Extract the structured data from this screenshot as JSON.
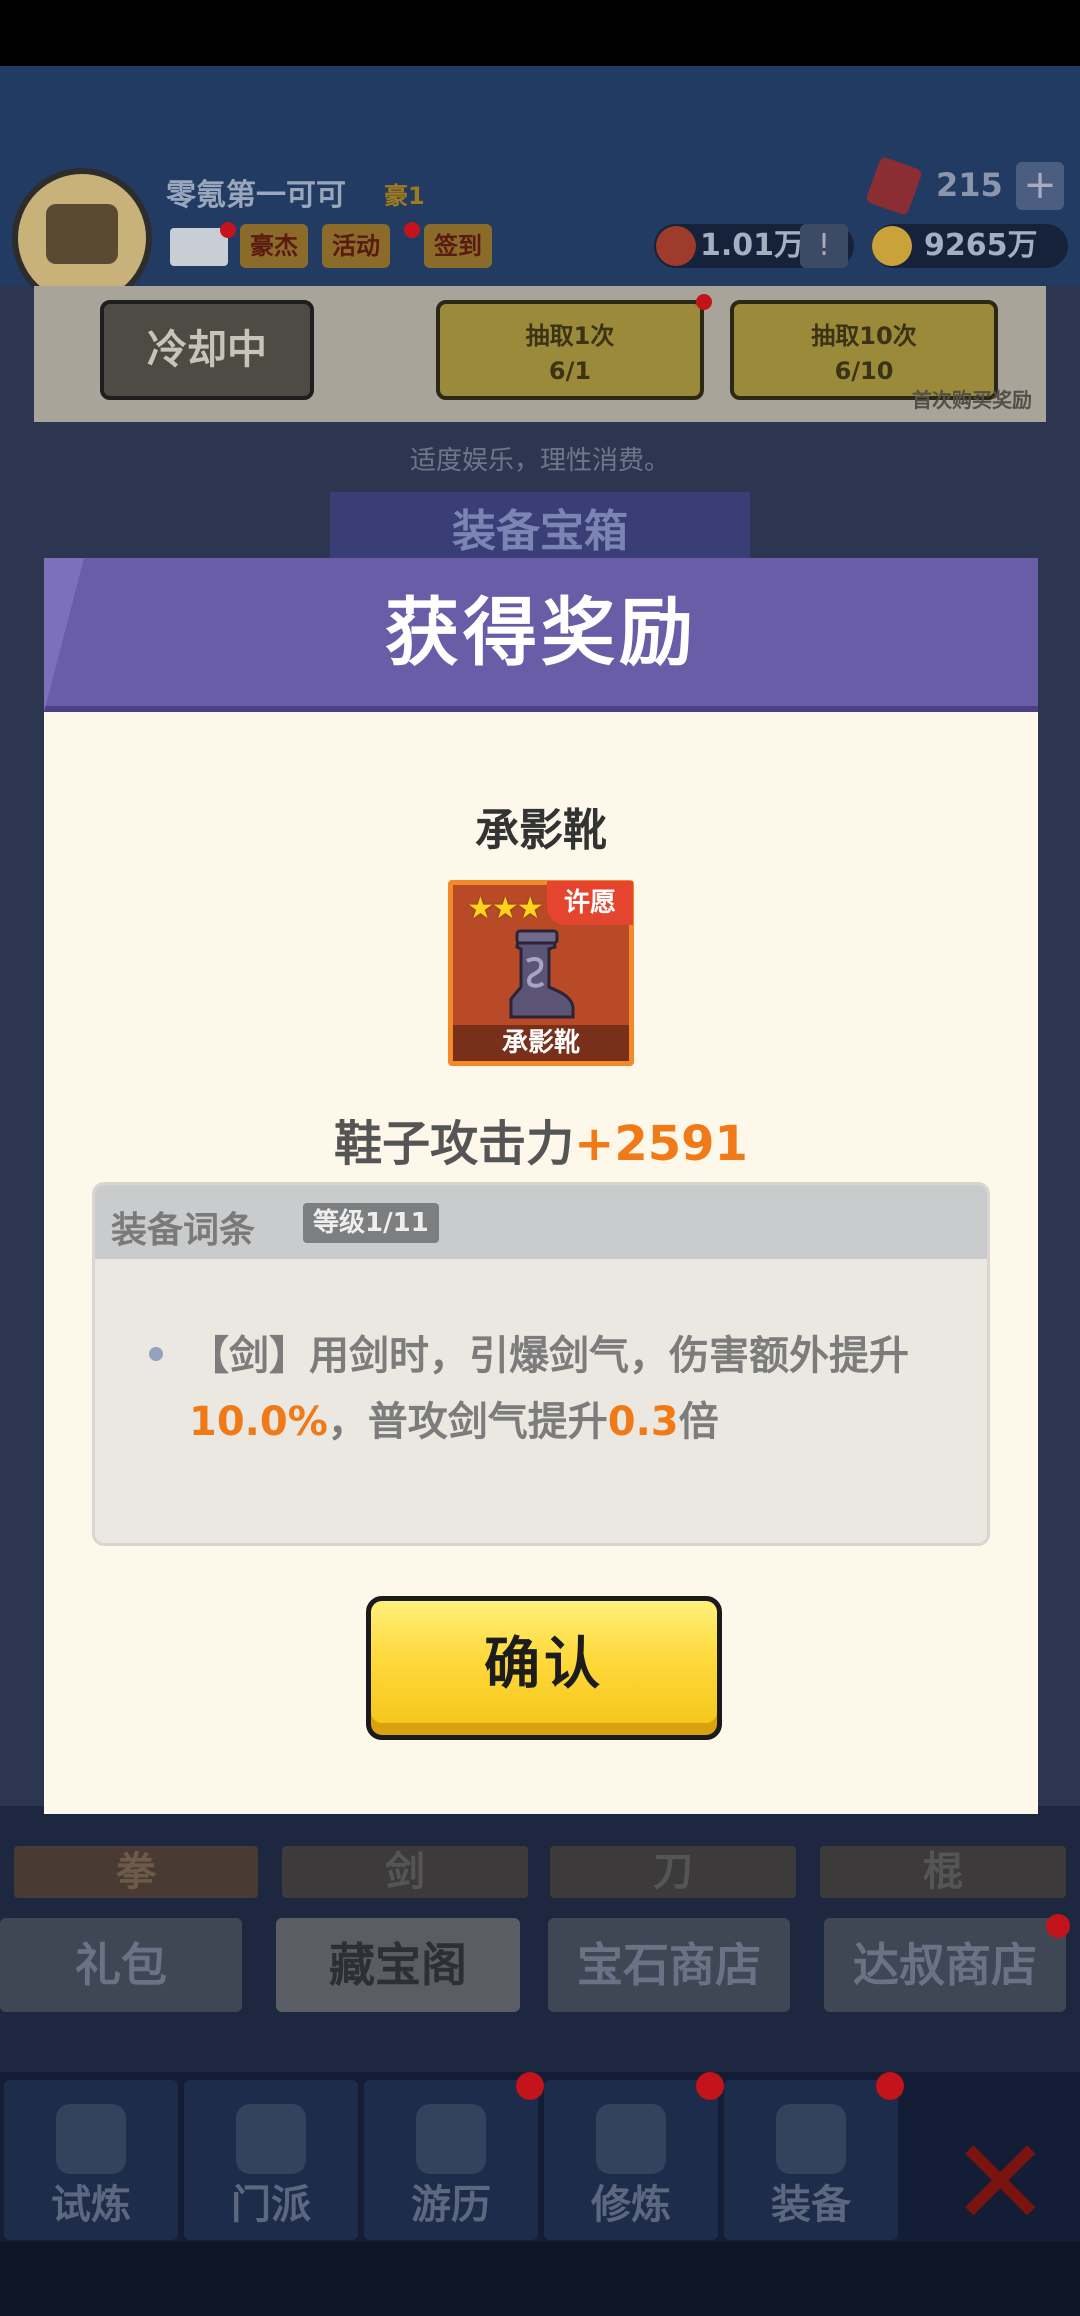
{
  "player": {
    "name": "零氪第一可可",
    "vip": "豪1"
  },
  "top_buttons": {
    "hero": "豪杰",
    "activity": "活动",
    "signin": "签到"
  },
  "resources": {
    "gems": "215",
    "power": "1.01万",
    "gold": "9265万",
    "plus": "+",
    "alert": "!"
  },
  "draw": {
    "cooldown": "冷却中",
    "draw1_label": "抽取1次",
    "draw1_count": "6/1",
    "draw10_label": "抽取10次",
    "draw10_count": "6/10",
    "first_purchase": "首次购买奖励"
  },
  "hint": "适度娱乐，理性消费。",
  "chest_title": "装备宝箱",
  "category_tabs": [
    "拳",
    "剑",
    "刀",
    "棍"
  ],
  "shop_tabs": [
    "礼包",
    "藏宝阁",
    "宝石商店",
    "达叔商店"
  ],
  "nav": [
    "试炼",
    "门派",
    "游历",
    "修炼",
    "装备"
  ],
  "modal": {
    "title": "获得奖励",
    "item_name": "承影靴",
    "card_label": "承影靴",
    "stars": "★★★",
    "wish_tag": "许愿",
    "stat_label": "鞋子攻击力",
    "stat_value": "+2591",
    "affix_title": "装备词条",
    "affix_level": "等级1/11",
    "affix_parts": [
      "【剑】用剑时，引爆剑气，伤害额外提升",
      "10.0%",
      "，普攻剑气提升",
      "0.3",
      "倍"
    ],
    "confirm": "确认"
  },
  "colors": {
    "modal_header": "#6a5da8",
    "accent_orange": "#f07a18",
    "confirm_yellow": "#ffd83a"
  }
}
